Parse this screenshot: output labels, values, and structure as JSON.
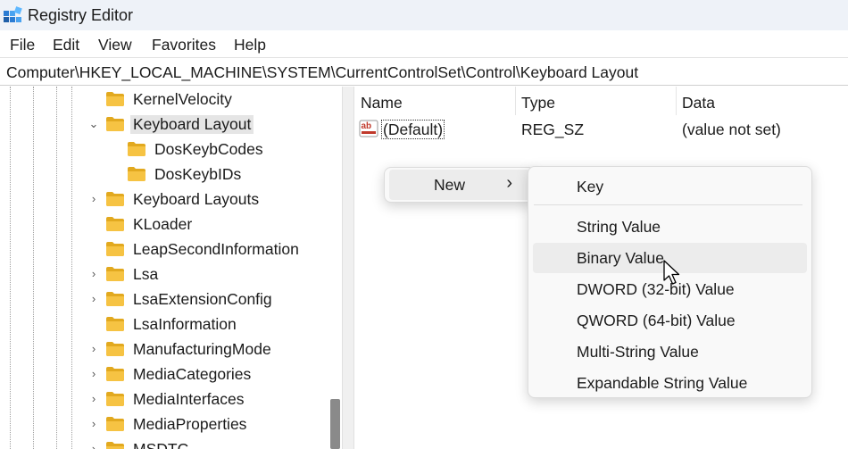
{
  "window": {
    "title": "Registry Editor",
    "icon": "registry-editor-icon"
  },
  "menubar": {
    "items": [
      "File",
      "Edit",
      "View",
      "Favorites",
      "Help"
    ]
  },
  "address": {
    "path": "Computer\\HKEY_LOCAL_MACHINE\\SYSTEM\\CurrentControlSet\\Control\\Keyboard Layout"
  },
  "tree": {
    "items": [
      {
        "label": "KernelVelocity"
      },
      {
        "label": "Keyboard Layout",
        "expanded": true,
        "selected": true
      },
      {
        "label": "DosKeybCodes"
      },
      {
        "label": "DosKeybIDs"
      },
      {
        "label": "Keyboard Layouts",
        "expandable": true
      },
      {
        "label": "KLoader"
      },
      {
        "label": "LeapSecondInformation"
      },
      {
        "label": "Lsa",
        "expandable": true
      },
      {
        "label": "LsaExtensionConfig",
        "expandable": true
      },
      {
        "label": "LsaInformation"
      },
      {
        "label": "ManufacturingMode",
        "expandable": true
      },
      {
        "label": "MediaCategories",
        "expandable": true
      },
      {
        "label": "MediaInterfaces",
        "expandable": true
      },
      {
        "label": "MediaProperties",
        "expandable": true
      },
      {
        "label": "MSDTC",
        "expandable": true
      }
    ]
  },
  "list": {
    "columns": [
      "Name",
      "Type",
      "Data"
    ],
    "rows": [
      {
        "name": "(Default)",
        "type": "REG_SZ",
        "data": "(value not set)",
        "icon": "string-value-icon"
      }
    ]
  },
  "context_menu": {
    "item": "New",
    "submenu_arrow": "chevron-right-icon"
  },
  "submenu": {
    "items": [
      "Key",
      "String Value",
      "Binary Value",
      "DWORD (32-bit) Value",
      "QWORD (64-bit) Value",
      "Multi-String Value",
      "Expandable String Value"
    ],
    "hovered": "Binary Value"
  },
  "colors": {
    "folder": "#f6c343",
    "folder_dark": "#e2a91f",
    "selection": "#e5e5e5",
    "menu_hover": "#ececec",
    "string_icon_red": "#c0392b"
  }
}
